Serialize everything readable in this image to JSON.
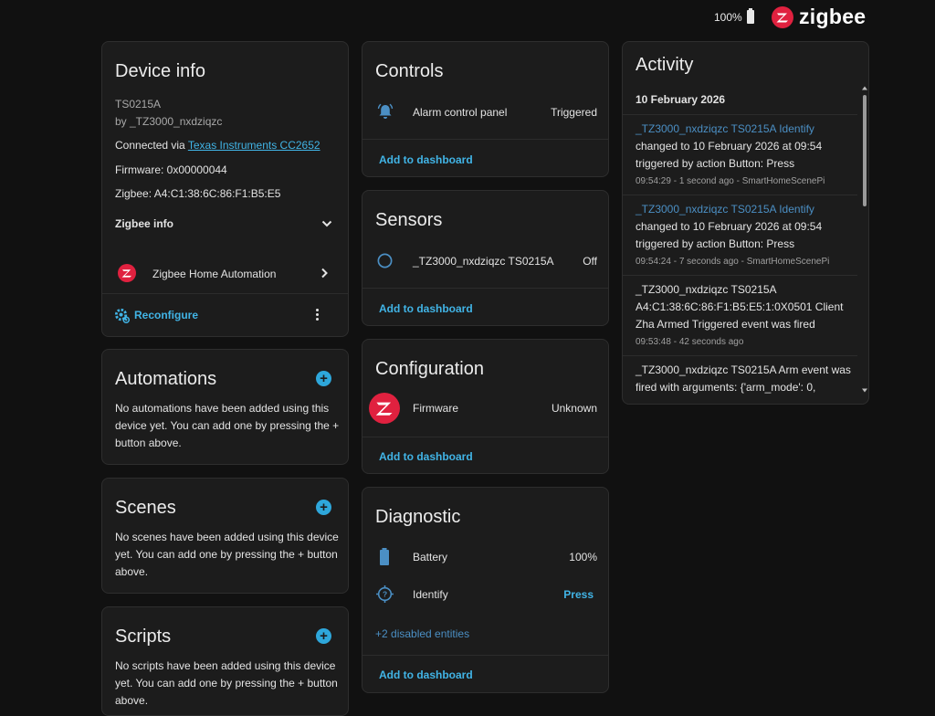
{
  "header": {
    "battery": "100%",
    "brand": "zigbee"
  },
  "device_info": {
    "title": "Device info",
    "model": "TS0215A",
    "manufacturer": "by _TZ3000_nxdziqzc",
    "connected_prefix": "Connected via ",
    "connected_link": "Texas Instruments CC2652",
    "firmware": "Firmware: 0x00000044",
    "zigbee_addr": "Zigbee: A4:C1:38:6C:86:F1:B5:E5",
    "zigbee_info": "Zigbee info",
    "integration": "Zigbee Home Automation",
    "reconfigure": "Reconfigure"
  },
  "automations": {
    "title": "Automations",
    "text": "No automations have been added using this device yet. You can add one by pressing the + button above."
  },
  "scenes": {
    "title": "Scenes",
    "text": "No scenes have been added using this device yet. You can add one by pressing the + button above."
  },
  "scripts": {
    "title": "Scripts",
    "text": "No scripts have been added using this device yet. You can add one by pressing the + button above."
  },
  "controls": {
    "title": "Controls",
    "entity": "Alarm control panel",
    "state": "Triggered",
    "add": "Add to dashboard"
  },
  "sensors": {
    "title": "Sensors",
    "entity": "_TZ3000_nxdziqzc TS0215A",
    "state": "Off",
    "add": "Add to dashboard"
  },
  "configuration": {
    "title": "Configuration",
    "entity": "Firmware",
    "state": "Unknown",
    "add": "Add to dashboard"
  },
  "diagnostic": {
    "title": "Diagnostic",
    "battery_label": "Battery",
    "battery_value": "100%",
    "identify_label": "Identify",
    "identify_action": "Press",
    "disabled": "+2 disabled entities",
    "add": "Add to dashboard"
  },
  "activity": {
    "title": "Activity",
    "date": "10 February 2026",
    "entries": [
      {
        "l1": "_TZ3000_nxdziqzc TS0215A Identify",
        "l2": "changed to 10 February 2026 at 09:54",
        "l3": "triggered by action Button: Press",
        "time": "09:54:29 - 1 second ago - SmartHomeScenePi"
      },
      {
        "l1": "_TZ3000_nxdziqzc TS0215A Identify",
        "l2": "changed to 10 February 2026 at 09:54",
        "l3": "triggered by action Button: Press",
        "time": "09:54:24 - 7 seconds ago - SmartHomeScenePi"
      },
      {
        "l1": "_TZ3000_nxdziqzc TS0215A",
        "l2": "A4:C1:38:6C:86:F1:B5:E5:1:0X0501 Client",
        "l3": "Zha Armed Triggered event was fired",
        "time": "09:53:48 - 42 seconds ago"
      },
      {
        "l1": "_TZ3000_nxdziqzc TS0215A Arm event was",
        "l2": "fired with arguments: {'arm_mode': 0,"
      }
    ]
  },
  "colors": {
    "accent": "#41b4e6",
    "zigbee_red": "#e0213f",
    "background": "#111111",
    "card": "#1c1c1c"
  }
}
